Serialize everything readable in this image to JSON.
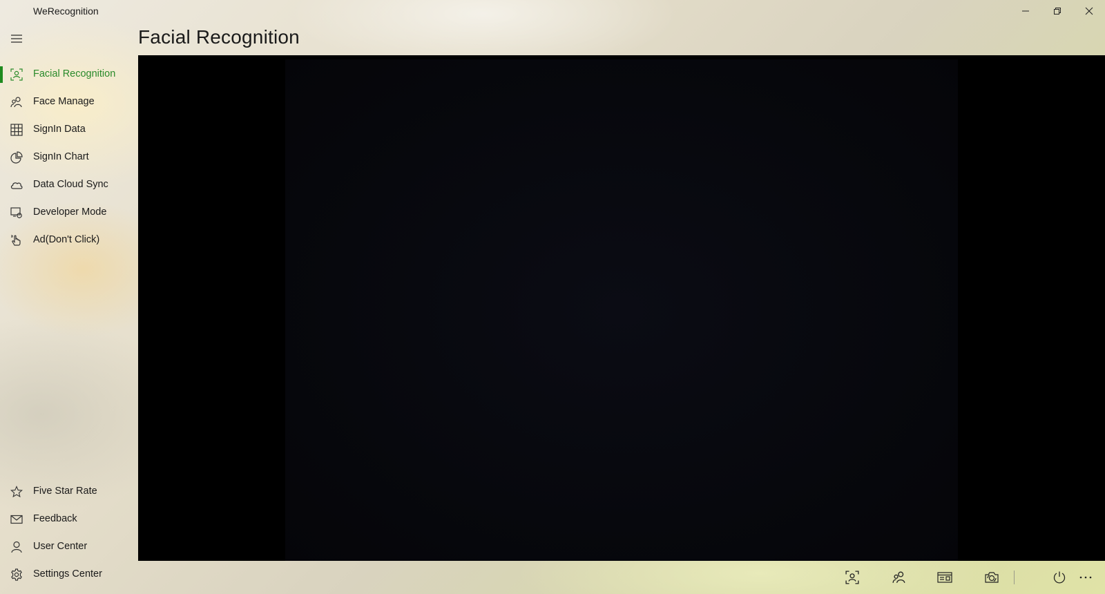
{
  "app": {
    "title": "WeRecognition"
  },
  "page": {
    "title": "Facial Recognition"
  },
  "colors": {
    "accent": "#1f8a1f",
    "video_background": "#000000"
  },
  "window_controls": [
    {
      "name": "minimize",
      "icon": "minimize-icon"
    },
    {
      "name": "maximize",
      "icon": "restore-icon"
    },
    {
      "name": "close",
      "icon": "close-icon"
    }
  ],
  "nav": {
    "menu_icon": "hamburger-icon",
    "items": [
      {
        "label": "Facial Recognition",
        "icon": "face-scan-icon",
        "active": true
      },
      {
        "label": "Face Manage",
        "icon": "people-icon",
        "active": false
      },
      {
        "label": "SignIn Data",
        "icon": "grid-table-icon",
        "active": false
      },
      {
        "label": "SignIn Chart",
        "icon": "pie-chart-icon",
        "active": false
      },
      {
        "label": "Data Cloud Sync",
        "icon": "cloud-icon",
        "active": false
      },
      {
        "label": "Developer Mode",
        "icon": "developer-icon",
        "active": false
      },
      {
        "label": "Ad(Don't Click)",
        "icon": "touch-hand-icon",
        "active": false
      }
    ],
    "footer_items": [
      {
        "label": "Five Star Rate",
        "icon": "star-icon"
      },
      {
        "label": "Feedback",
        "icon": "mail-icon"
      },
      {
        "label": "User Center",
        "icon": "user-icon"
      },
      {
        "label": "Settings Center",
        "icon": "gear-icon"
      }
    ]
  },
  "command_bar": [
    {
      "name": "face-scan",
      "icon": "face-scan-icon"
    },
    {
      "name": "people",
      "icon": "people-icon"
    },
    {
      "name": "id-card",
      "icon": "id-card-icon"
    },
    {
      "name": "camera-switch",
      "icon": "camera-switch-icon"
    },
    {
      "name": "power",
      "icon": "power-icon"
    },
    {
      "name": "more",
      "icon": "more-icon"
    }
  ]
}
